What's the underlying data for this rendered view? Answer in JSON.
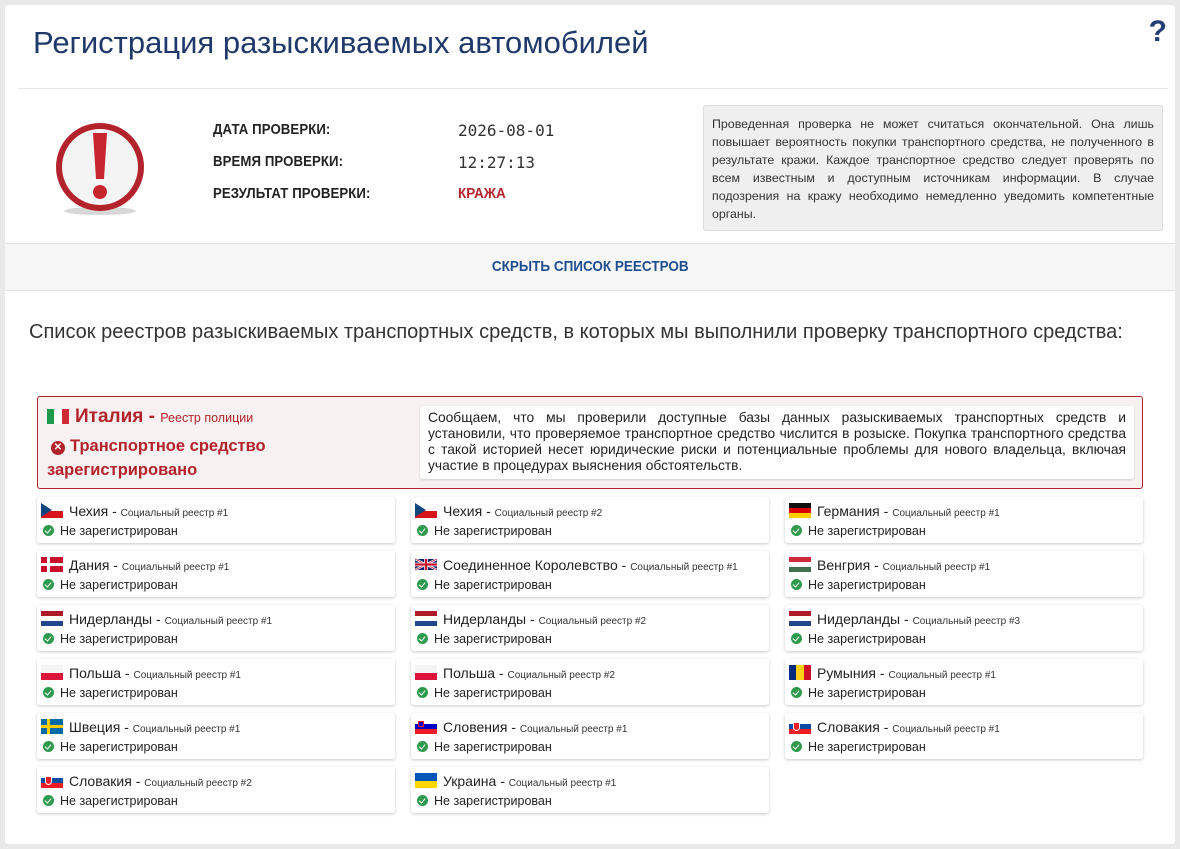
{
  "page": {
    "title": "Регистрация разыскиваемых автомобилей",
    "help_label": "?"
  },
  "check": {
    "date_label": "ДАТА ПРОВЕРКИ:",
    "date_value": "2026-08-01",
    "time_label": "ВРЕМЯ ПРОВЕРКИ:",
    "time_value": "12:27:13",
    "result_label": "РЕЗУЛЬТАТ ПРОВЕРКИ:",
    "result_value": "КРАЖА",
    "result_color": "#b3232b"
  },
  "disclaimer": "Проведенная проверка не может считаться окончательной. Она лишь повышает вероятность покупки транспортного средства, не полученного в результате кражи. Каждое транспортное средство следует проверять по всем известным и доступным источникам информации. В случае подозрения на кражу необходимо немедленно уведомить компетентные органы.",
  "toggle_label": "СКРЫТЬ СПИСОК РЕЕСТРОВ",
  "section_heading": "Список реестров разыскиваемых транспортных средств, в которых мы выполнили проверку транспортного средства:",
  "alert": {
    "country": "Италия",
    "separator": " - ",
    "registry": "Реестр полиции",
    "flag": "it",
    "status": "Транспортное средство зарегистрировано",
    "message": "Сообщаем, что мы проверили доступные базы данных разыскиваемых транспортных средств и установили, что проверяемое транспортное средство числится в розыске. Покупка транспортного средства с такой историей несет юридические риски и потенциальные проблемы для нового владельца, включая участие в процедурах выяснения обстоятельств."
  },
  "registries": [
    {
      "country": "Чехия",
      "registry": "Социальный реестр #1",
      "flag": "cz",
      "status": "Не зарегистрирован"
    },
    {
      "country": "Чехия",
      "registry": "Социальный реестр #2",
      "flag": "cz",
      "status": "Не зарегистрирован"
    },
    {
      "country": "Германия",
      "registry": "Социальный реестр #1",
      "flag": "de",
      "status": "Не зарегистрирован"
    },
    {
      "country": "Дания",
      "registry": "Социальный реестр #1",
      "flag": "dk",
      "status": "Не зарегистрирован"
    },
    {
      "country": "Соединенное Королевство",
      "registry": "Социальный реестр #1",
      "flag": "gb",
      "status": "Не зарегистрирован"
    },
    {
      "country": "Венгрия",
      "registry": "Социальный реестр #1",
      "flag": "hu",
      "status": "Не зарегистрирован"
    },
    {
      "country": "Нидерланды",
      "registry": "Социальный реестр #1",
      "flag": "nl",
      "status": "Не зарегистрирован"
    },
    {
      "country": "Нидерланды",
      "registry": "Социальный реестр #2",
      "flag": "nl",
      "status": "Не зарегистрирован"
    },
    {
      "country": "Нидерланды",
      "registry": "Социальный реестр #3",
      "flag": "nl",
      "status": "Не зарегистрирован"
    },
    {
      "country": "Польша",
      "registry": "Социальный реестр #1",
      "flag": "pl",
      "status": "Не зарегистрирован"
    },
    {
      "country": "Польша",
      "registry": "Социальный реестр #2",
      "flag": "pl",
      "status": "Не зарегистрирован"
    },
    {
      "country": "Румыния",
      "registry": "Социальный реестр #1",
      "flag": "ro",
      "status": "Не зарегистрирован"
    },
    {
      "country": "Швеция",
      "registry": "Социальный реестр #1",
      "flag": "se",
      "status": "Не зарегистрирован"
    },
    {
      "country": "Словения",
      "registry": "Социальный реестр #1",
      "flag": "si",
      "status": "Не зарегистрирован"
    },
    {
      "country": "Словакия",
      "registry": "Социальный реестр #1",
      "flag": "sk",
      "status": "Не зарегистрирован"
    },
    {
      "country": "Словакия",
      "registry": "Социальный реестр #2",
      "flag": "sk",
      "status": "Не зарегистрирован"
    },
    {
      "country": "Украина",
      "registry": "Социальный реестр #1",
      "flag": "ua",
      "status": "Не зарегистрирован"
    }
  ],
  "colors": {
    "title": "#1f3a6a",
    "alert": "#b3232b",
    "ok": "#2e9a4e",
    "link": "#1f4e8f"
  }
}
